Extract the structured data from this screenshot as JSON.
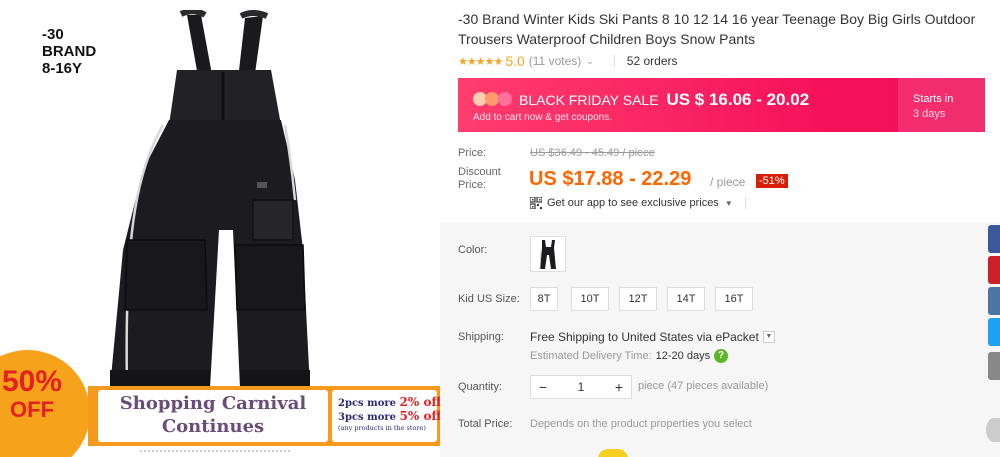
{
  "image": {
    "brand_lines": [
      "-30",
      "BRAND",
      "8-16Y"
    ],
    "promo": {
      "circle_big": "50%",
      "circle_small": "OFF",
      "carnival_line1": "Shopping Carnival",
      "carnival_line2": "Continues",
      "deal1_prefix": "2pcs more",
      "deal1_pct": "2% off",
      "deal2_prefix": "3pcs more",
      "deal2_pct": "5% off",
      "deal_note": "(any products in the store)"
    }
  },
  "product": {
    "title": "-30 Brand Winter Kids Ski Pants 8 10 12 14 16 year Teenage Boy Big Girls Outdoor Trousers Waterproof Children Boys Snow Pants",
    "rating": "5.0",
    "votes": "(11 votes)",
    "orders": "52 orders"
  },
  "black_friday": {
    "title": "BLACK FRIDAY SALE",
    "price": "US $ 16.06 - 20.02",
    "sub": "Add to cart now & get coupons.",
    "starts_label": "Starts in",
    "starts_days": "3 days",
    "dot_colors": [
      "#ffcfae",
      "#ff9a6a",
      "#ff6f9c"
    ]
  },
  "pricing": {
    "price_label": "Price:",
    "original_price": "US $36.49 - 45.49 / piece",
    "discount_label_1": "Discount",
    "discount_label_2": "Price:",
    "discount_price": "US $17.88 - 22.29",
    "per_piece": "/ piece",
    "discount_badge": "-51%",
    "app_text": "Get our app to see exclusive prices"
  },
  "options": {
    "color_label": "Color:",
    "size_label": "Kid US Size:",
    "sizes": [
      "8T",
      "10T",
      "12T",
      "14T",
      "16T"
    ],
    "shipping_label": "Shipping:",
    "shipping_text": "Free Shipping to United States via ePacket",
    "delivery_label": "Estimated Delivery Time:",
    "delivery_days": "12-20 days",
    "help_symbol": "?",
    "quantity_label": "Quantity:",
    "qty_minus": "−",
    "qty_value": "1",
    "qty_plus": "+",
    "qty_note": "piece (47 pieces available)",
    "total_label": "Total Price:",
    "total_value": "Depends on the product properties you select"
  },
  "share_colors": [
    "#3b5998",
    "#cb2027",
    "#4c75a3",
    "#1da1f2",
    "#888888"
  ],
  "accent": "#f60"
}
